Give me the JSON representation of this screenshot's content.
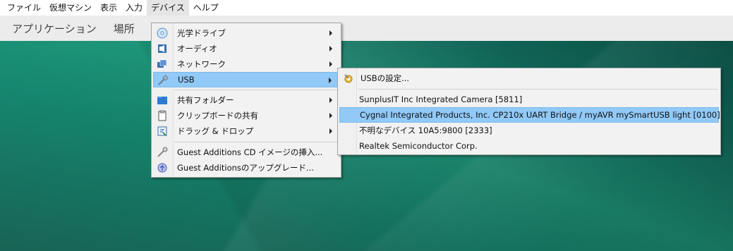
{
  "menubar": {
    "items": [
      "ファイル",
      "仮想マシン",
      "表示",
      "入力",
      "デバイス",
      "ヘルプ"
    ]
  },
  "guest_panel": {
    "applications": "アプリケーション",
    "places": "場所"
  },
  "devices_menu": {
    "items": [
      {
        "label": "光学ドライブ",
        "icon": "optical-drive-icon"
      },
      {
        "label": "オーディオ",
        "icon": "audio-icon"
      },
      {
        "label": "ネットワーク",
        "icon": "network-icon"
      },
      {
        "label": "USB",
        "icon": "usb-icon"
      },
      {
        "label": "共有フォルダー",
        "icon": "shared-folder-icon"
      },
      {
        "label": "クリップボードの共有",
        "icon": "clipboard-icon"
      },
      {
        "label": "ドラッグ & ドロップ",
        "icon": "drag-drop-icon"
      },
      {
        "label": "Guest Additions CD イメージの挿入...",
        "icon": "guest-additions-cd-icon"
      },
      {
        "label": "Guest Additionsのアップグレード...",
        "icon": "guest-additions-upgrade-icon"
      }
    ]
  },
  "usb_menu": {
    "settings": {
      "label": "USBの設定...",
      "icon": "usb-settings-icon"
    },
    "devices": [
      "SunplusIT Inc Integrated Camera [5811]",
      "Cygnal Integrated Products, Inc. CP210x UART Bridge / myAVR mySmartUSB light [0100]",
      "不明なデバイス 10A5:9800 [2333]",
      "Realtek Semiconductor Corp."
    ]
  },
  "colors": {
    "highlight": "#91c9f7",
    "desktop": "#168a72"
  }
}
